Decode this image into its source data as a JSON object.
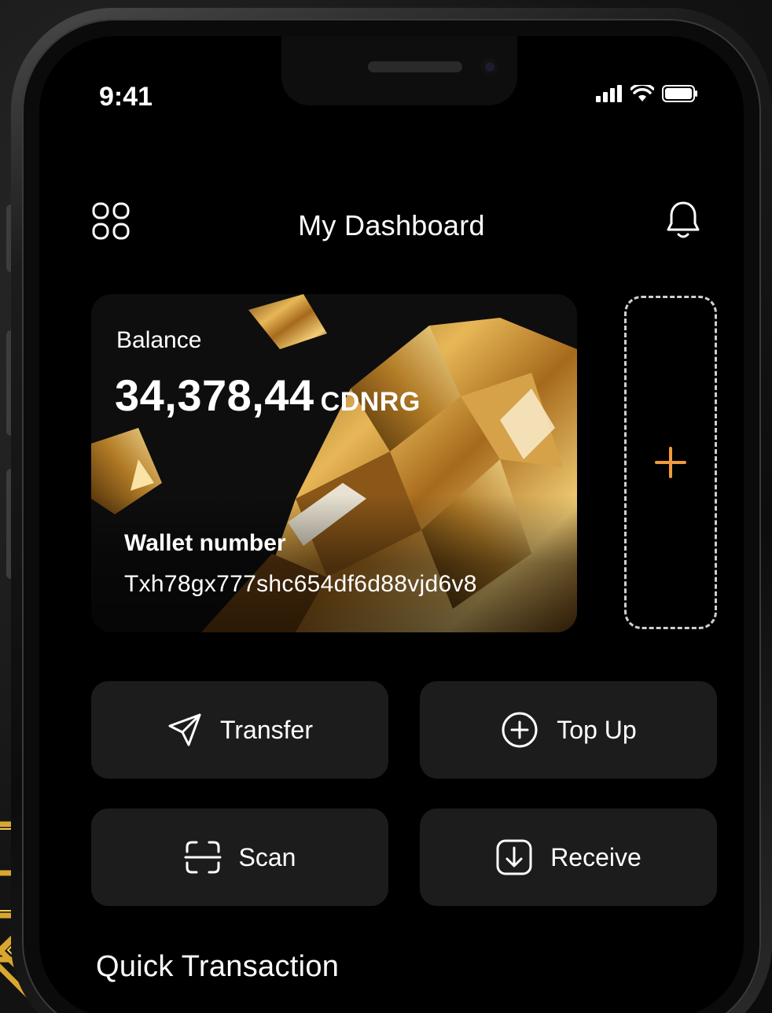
{
  "status_bar": {
    "time": "9:41"
  },
  "header": {
    "title": "My Dashboard",
    "menu_icon": "grid-icon",
    "notification_icon": "bell-icon"
  },
  "balance_card": {
    "label": "Balance",
    "amount": "34,378,44",
    "currency": "CDNRG",
    "wallet_label": "Wallet number",
    "wallet_number": "Txh78gx777shc654df6d88vjd6v8"
  },
  "add_card": {
    "icon": "plus-icon",
    "accent_color": "#f09a3e"
  },
  "actions": [
    {
      "label": "Transfer",
      "icon": "send-icon"
    },
    {
      "label": "Top Up",
      "icon": "plus-circle-icon"
    },
    {
      "label": "Scan",
      "icon": "scan-icon"
    },
    {
      "label": "Receive",
      "icon": "download-icon"
    }
  ],
  "sections": {
    "quick_transaction": "Quick Transaction"
  }
}
